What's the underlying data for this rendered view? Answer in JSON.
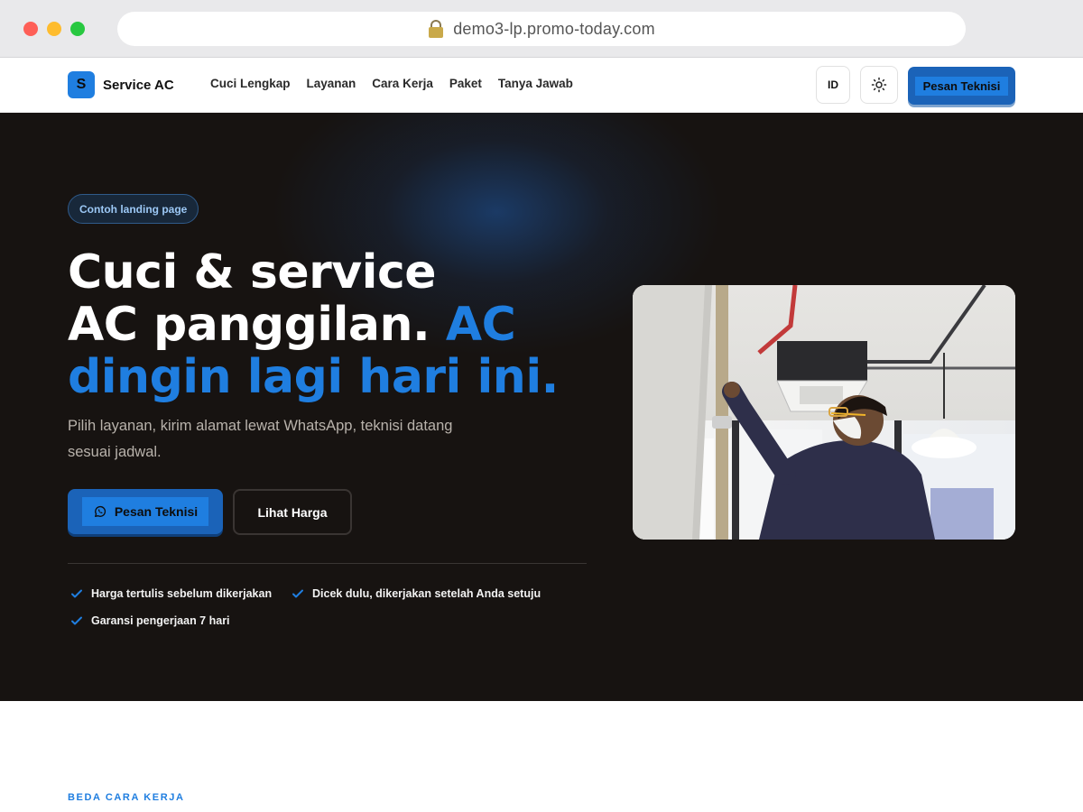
{
  "browser": {
    "url": "demo3-lp.promo-today.com",
    "lock_icon": "lock-icon"
  },
  "header": {
    "logo_letter": "S",
    "brand": "Service AC",
    "nav": [
      {
        "label": "Cuci Lengkap"
      },
      {
        "label": "Layanan"
      },
      {
        "label": "Cara Kerja"
      },
      {
        "label": "Paket"
      },
      {
        "label": "Tanya Jawab"
      }
    ],
    "lang_label": "ID",
    "theme_icon": "sun-icon",
    "cta_label": "Pesan Teknisi"
  },
  "hero": {
    "badge": "Contoh landing page",
    "headline_line1": "Cuci & service",
    "headline_line2_white": "AC panggilan.",
    "headline_line2_blue": "AC",
    "headline_line3_blue": "dingin lagi hari ini.",
    "subtitle": "Pilih layanan, kirim alamat lewat WhatsApp, teknisi datang sesuai jadwal.",
    "primary_cta": "Pesan Teknisi",
    "primary_cta_icon": "whatsapp-icon",
    "secondary_cta": "Lihat Harga",
    "features": [
      {
        "label": "Harga tertulis sebelum dikerjakan"
      },
      {
        "label": "Dicek dulu, dikerjakan setelah Anda setuju"
      },
      {
        "label": "Garansi pengerjaan 7 hari"
      }
    ]
  },
  "section": {
    "eyebrow": "BEDA CARA KERJA"
  },
  "colors": {
    "accent": "#1f7ee0",
    "hero_bg": "#171311"
  }
}
